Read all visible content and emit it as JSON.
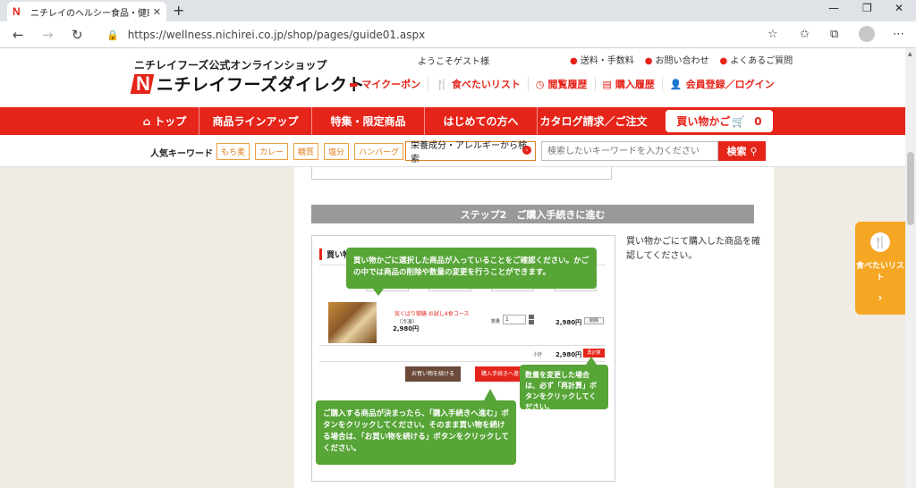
{
  "browser": {
    "tab_title": "ニチレイのヘルシー食品・健康管理食",
    "favicon": "N",
    "close": "✕",
    "new_tab": "+",
    "url": "https://wellness.nichirei.co.jp/shop/pages/guide01.aspx",
    "win_min": "—",
    "win_max": "❐",
    "win_close": "✕"
  },
  "header": {
    "logo_sub": "ニチレイフーズ公式オンラインショップ",
    "logo_mark": "N",
    "logo_main": "ニチレイフーズダイレクト",
    "welcome": "ようこそゲスト様",
    "top_links": [
      "送料・手数料",
      "お問い合わせ",
      "よくあるご質問"
    ],
    "main_links": [
      {
        "label": "マイクーポン",
        "icon": "coupon-icon"
      },
      {
        "label": "食べたいリスト",
        "icon": "fork-knife-icon"
      },
      {
        "label": "閲覧履歴",
        "icon": "clock-icon"
      },
      {
        "label": "購入履歴",
        "icon": "receipt-icon"
      },
      {
        "label": "会員登録／ログイン",
        "icon": "user-icon"
      }
    ]
  },
  "nav": {
    "items": [
      "トップ",
      "商品ラインアップ",
      "特集・限定商品",
      "はじめての方へ",
      "カタログ請求／ご注文"
    ],
    "cart_label": "買い物かご",
    "cart_count": "0"
  },
  "keywords": {
    "label": "人気キーワード",
    "tags": [
      "もち麦",
      "カレー",
      "糖質",
      "塩分",
      "ハンバーグ"
    ],
    "select_value": "栄養成分・アレルギーから検索",
    "search_placeholder": "検索したいキーワードを入力ください",
    "search_button": "検索"
  },
  "content": {
    "step_title": "ステップ2　ご購入手続きに進む",
    "step_desc": "買い物かごにて購入した商品を確認してください。",
    "shot": {
      "title": "買い物かご",
      "product_name": "気くばり御膳 お試し4食コース",
      "product_sub": "（冷凍）",
      "product_price": "2,980円",
      "qty_label": "数量",
      "qty_value": "1",
      "line_price": "2,980円",
      "delete": "削除",
      "subtotal_label": "小計",
      "subtotal": "2,980円",
      "recalc": "再計算",
      "continue": "お買い物を続ける",
      "proceed": "購入手続きへ進む"
    },
    "callouts": [
      "買い物かごに選択した商品が入っていることをご確認ください。かごの中では商品の削除や数量の変更を行うことができます。",
      "数量を変更した場合は、必ず「再計算」ボタンをクリックしてください。",
      "ご購入する商品が決まったら、「購入手続きへ進む」ボタンをクリックしてください。そのまま買い物を続ける場合は、「お買い物を続ける」ボタンをクリックしてください。"
    ]
  },
  "float": {
    "label": "食べたいリスト",
    "arrow": "›"
  },
  "colors": {
    "brand_red": "#e5241a",
    "callout_green": "#57a537",
    "float_orange": "#f5a623"
  }
}
